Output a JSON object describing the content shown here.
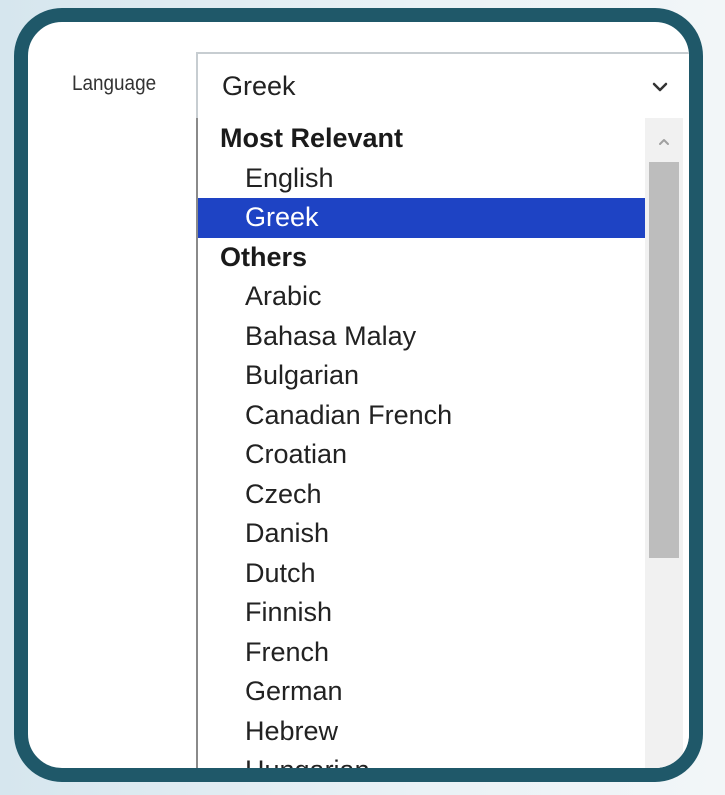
{
  "field": {
    "label": "Language",
    "selected_value": "Greek"
  },
  "dropdown": {
    "groups": [
      {
        "label": "Most Relevant",
        "options": [
          "English",
          "Greek"
        ]
      },
      {
        "label": "Others",
        "options": [
          "Arabic",
          "Bahasa Malay",
          "Bulgarian",
          "Canadian French",
          "Croatian",
          "Czech",
          "Danish",
          "Dutch",
          "Finnish",
          "French",
          "German",
          "Hebrew",
          "Hungarian"
        ]
      }
    ],
    "highlighted_option": "Greek"
  },
  "colors": {
    "frame_border": "#1f5869",
    "highlight": "#1e43c4",
    "scroll_thumb": "#bdbdbd"
  },
  "icons": {
    "select_arrow": "chevron-down-icon",
    "scroll_up": "scroll-up-arrow-icon"
  }
}
